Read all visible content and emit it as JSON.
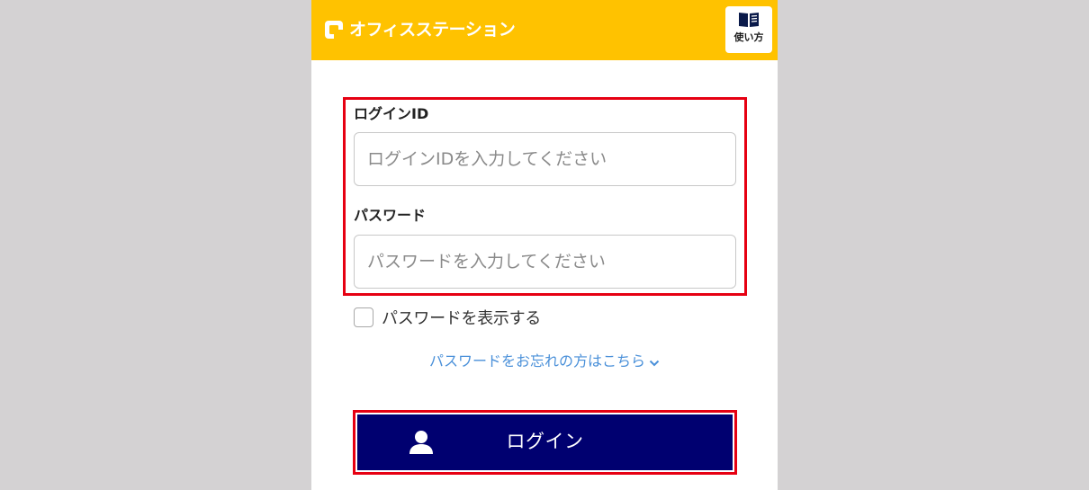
{
  "header": {
    "brand_name": "オフィスステーション",
    "help_label": "使い方",
    "logo_icon": "office-station-logo-icon",
    "help_icon": "book-icon",
    "accent_color": "#ffc200"
  },
  "form": {
    "login_id": {
      "label": "ログインID",
      "placeholder": "ログインIDを入力してください",
      "value": ""
    },
    "password": {
      "label": "パスワード",
      "placeholder": "パスワードを入力してください",
      "value": ""
    },
    "show_password": {
      "label": "パスワードを表示する",
      "checked": false
    },
    "forgot_link": "パスワードをお忘れの方はこちら"
  },
  "login_button": {
    "label": "ログイン",
    "icon": "user-icon",
    "color": "#000070"
  },
  "highlight_color": "#e60012"
}
